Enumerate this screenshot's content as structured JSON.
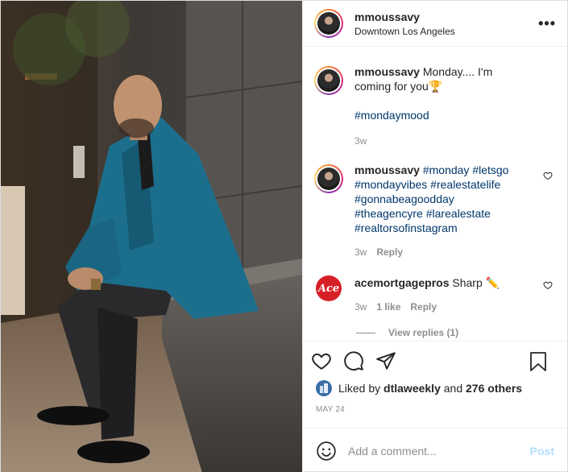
{
  "header": {
    "username": "mmoussavy",
    "location": "Downtown Los Angeles",
    "more_label": "•••"
  },
  "caption": {
    "username": "mmoussavy",
    "text": "Monday.... I'm coming for you",
    "emoji": "🏆",
    "hashtag": "#mondaymood",
    "time": "3w"
  },
  "comments": [
    {
      "username": "mmoussavy",
      "tags": [
        "#monday",
        "#letsgo",
        "#mondayvibes",
        "#realestatelife",
        "#gonnabeagoodday",
        "#theagencyre",
        "#larealestate",
        "#realtorsofinstagram"
      ],
      "time": "3w",
      "reply_label": "Reply"
    },
    {
      "username": "acemortgagepros",
      "avatar_text": "Ace",
      "text": "Sharp",
      "emoji": "✏️",
      "time": "3w",
      "likes": "1 like",
      "reply_label": "Reply",
      "view_replies": "View replies (1)"
    }
  ],
  "likes": {
    "prefix": "Liked by",
    "user": "dtlaweekly",
    "and": "and",
    "others": "276 others"
  },
  "date": "MAY 24",
  "add_comment": {
    "placeholder": "Add a comment...",
    "post_label": "Post"
  },
  "colors": {
    "link": "#00376b",
    "muted": "#8e8e8e",
    "post_disabled": "#b2dffc",
    "blazer": "#1c6f8c"
  }
}
